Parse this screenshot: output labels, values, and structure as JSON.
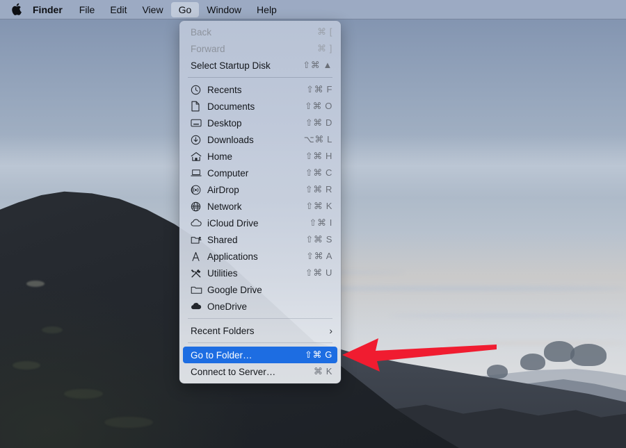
{
  "theme": {
    "menubar_bg": "#9eacc4",
    "menu_bg": "#c8d0de",
    "highlight_blue": "#1d6de2",
    "highlight_text": "#ffffff",
    "text_color": "#14171c",
    "disabled_text": "#8d939d",
    "shortcut_text": "#6a6f78",
    "annotation_red": "#f01c30"
  },
  "menubar": {
    "apple_icon": "apple-logo-icon",
    "items": [
      {
        "label": "Finder",
        "bold": true,
        "active": false
      },
      {
        "label": "File",
        "bold": false,
        "active": false
      },
      {
        "label": "Edit",
        "bold": false,
        "active": false
      },
      {
        "label": "View",
        "bold": false,
        "active": false
      },
      {
        "label": "Go",
        "bold": false,
        "active": true
      },
      {
        "label": "Window",
        "bold": false,
        "active": false
      },
      {
        "label": "Help",
        "bold": false,
        "active": false
      }
    ]
  },
  "go_menu": {
    "open_for": "Go",
    "groups": [
      {
        "items": [
          {
            "label": "Back",
            "shortcut": "⌘ [",
            "icon": null,
            "disabled": true,
            "selected": false
          },
          {
            "label": "Forward",
            "shortcut": "⌘ ]",
            "icon": null,
            "disabled": true,
            "selected": false
          },
          {
            "label": "Select Startup Disk",
            "shortcut": "⇧⌘ ▲",
            "icon": null,
            "disabled": false,
            "selected": false
          }
        ]
      },
      {
        "items": [
          {
            "label": "Recents",
            "shortcut": "⇧⌘ F",
            "icon": "clock-icon",
            "disabled": false,
            "selected": false
          },
          {
            "label": "Documents",
            "shortcut": "⇧⌘ O",
            "icon": "document-icon",
            "disabled": false,
            "selected": false
          },
          {
            "label": "Desktop",
            "shortcut": "⇧⌘ D",
            "icon": "desktop-icon",
            "disabled": false,
            "selected": false
          },
          {
            "label": "Downloads",
            "shortcut": "⌥⌘ L",
            "icon": "download-icon",
            "disabled": false,
            "selected": false
          },
          {
            "label": "Home",
            "shortcut": "⇧⌘ H",
            "icon": "home-icon",
            "disabled": false,
            "selected": false
          },
          {
            "label": "Computer",
            "shortcut": "⇧⌘ C",
            "icon": "computer-icon",
            "disabled": false,
            "selected": false
          },
          {
            "label": "AirDrop",
            "shortcut": "⇧⌘ R",
            "icon": "airdrop-icon",
            "disabled": false,
            "selected": false
          },
          {
            "label": "Network",
            "shortcut": "⇧⌘ K",
            "icon": "network-globe-icon",
            "disabled": false,
            "selected": false
          },
          {
            "label": "iCloud Drive",
            "shortcut": "⇧⌘ I",
            "icon": "cloud-icon",
            "disabled": false,
            "selected": false
          },
          {
            "label": "Shared",
            "shortcut": "⇧⌘ S",
            "icon": "shared-folder-icon",
            "disabled": false,
            "selected": false
          },
          {
            "label": "Applications",
            "shortcut": "⇧⌘ A",
            "icon": "applications-icon",
            "disabled": false,
            "selected": false
          },
          {
            "label": "Utilities",
            "shortcut": "⇧⌘ U",
            "icon": "utilities-icon",
            "disabled": false,
            "selected": false
          },
          {
            "label": "Google Drive",
            "shortcut": "",
            "icon": "folder-icon",
            "disabled": false,
            "selected": false
          },
          {
            "label": "OneDrive",
            "shortcut": "",
            "icon": "onedrive-cloud-icon",
            "disabled": false,
            "selected": false
          }
        ]
      },
      {
        "items": [
          {
            "label": "Recent Folders",
            "shortcut": "",
            "icon": null,
            "submenu": true,
            "disabled": false,
            "selected": false
          }
        ]
      },
      {
        "items": [
          {
            "label": "Go to Folder…",
            "shortcut": "⇧⌘ G",
            "icon": null,
            "disabled": false,
            "selected": true
          },
          {
            "label": "Connect to Server…",
            "shortcut": "⌘ K",
            "icon": null,
            "disabled": false,
            "selected": false
          }
        ]
      }
    ]
  },
  "annotation": {
    "arrow": {
      "name": "red-pointer-arrow",
      "direction": "left",
      "color": "#f01c30",
      "points_at": "Go to Folder…"
    }
  },
  "desktop": {
    "wallpaper_description": "Dusk hillside landscape with layered ridges under pale blue-gray sky"
  }
}
